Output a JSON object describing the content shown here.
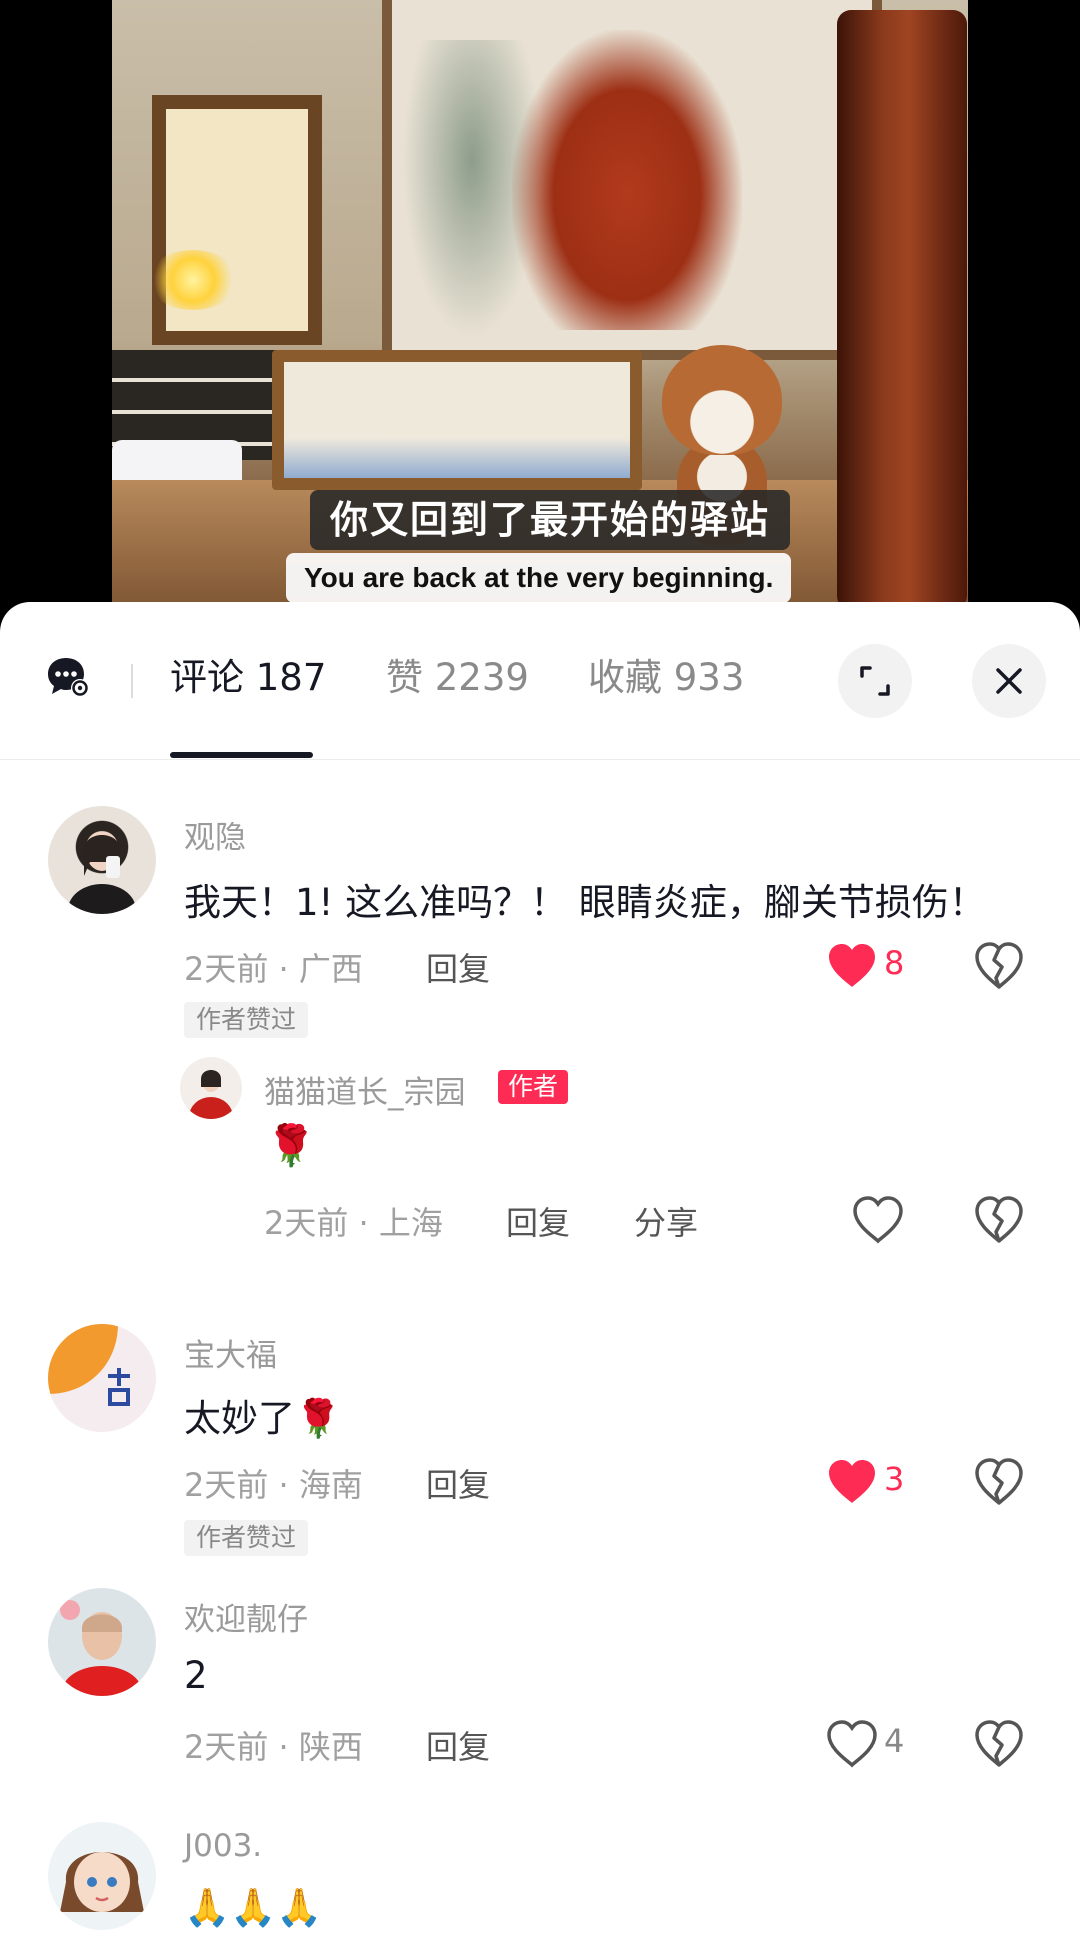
{
  "video": {
    "subtitle_cn": "你又回到了最开始的驿站",
    "subtitle_en": "You are back at the very beginning."
  },
  "tabs": [
    {
      "label": "评论 187",
      "active": true
    },
    {
      "label": "赞 2239",
      "active": false
    },
    {
      "label": "收藏 933",
      "active": false
    }
  ],
  "comments": [
    {
      "username": "观隐",
      "content": "我天！1! 这么准吗？！ 眼睛炎症，腳关节损伤！",
      "time": "2天前",
      "location": "广西",
      "reply_label": "回复",
      "likes": "8",
      "liked": true,
      "author_liked_badge": "作者赞过",
      "reply": {
        "username": "猫猫道长_宗园",
        "author_tag": "作者",
        "content": "🌹",
        "time": "2天前",
        "location": "上海",
        "reply_label": "回复",
        "share_label": "分享"
      }
    },
    {
      "username": "宝大福",
      "content": "太妙了🌹",
      "time": "2天前",
      "location": "海南",
      "reply_label": "回复",
      "likes": "3",
      "liked": true,
      "author_liked_badge": "作者赞过"
    },
    {
      "username": "欢迎靓仔",
      "content": "2",
      "time": "2天前",
      "location": "陕西",
      "reply_label": "回复",
      "likes": "4",
      "liked": false
    },
    {
      "username": "J003.",
      "content": "🙏🙏🙏"
    }
  ],
  "meta_separator": " · ",
  "colors": {
    "like_red": "#fe2c55",
    "text_primary": "#161823",
    "text_secondary": "#a0a0a0"
  },
  "icons": {
    "comment_settings": "comment-settings-icon",
    "expand": "expand-icon",
    "close": "close-icon",
    "like": "heart-icon",
    "dislike": "broken-heart-icon"
  }
}
